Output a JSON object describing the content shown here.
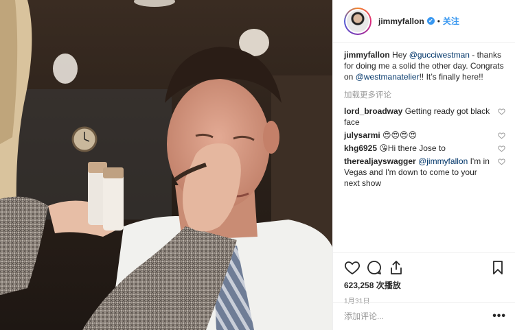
{
  "header": {
    "username": "jimmyfallon",
    "separator": "•",
    "follow_label": "关注",
    "verified_glyph": "✔"
  },
  "caption": {
    "username": "jimmyfallon",
    "text_1": " Hey ",
    "mention_1": "@gucciwestman",
    "text_2": " - thanks for doing me a solid the other day. Congrats on ",
    "mention_2": "@westmanatelier",
    "text_3": "!! It’s finally here!!"
  },
  "load_more_label": "加载更多评论",
  "comments": [
    {
      "username": "lord_broadway",
      "text": " Getting ready got black face"
    },
    {
      "username": "julysarmi",
      "text": " 😍😍😍😍"
    },
    {
      "username": "khg6925",
      "text": " 😘Hi there Jose to"
    },
    {
      "username": "therealjayswagger",
      "mention": " @jimmyfallon",
      "text": " I'm in Vegas and I'm down to come to your next show"
    }
  ],
  "icons": {
    "like": "heart-icon",
    "comment": "comment-icon",
    "share": "share-icon",
    "save": "bookmark-icon",
    "more": "more-options-icon"
  },
  "stats": {
    "views": "623,258 次播放",
    "date": "1月31日"
  },
  "add_comment": {
    "placeholder": "添加评论...",
    "more_label": "•••"
  },
  "colors": {
    "link": "#3897f0",
    "mention": "#003569",
    "muted": "#999999",
    "text": "#262626"
  }
}
